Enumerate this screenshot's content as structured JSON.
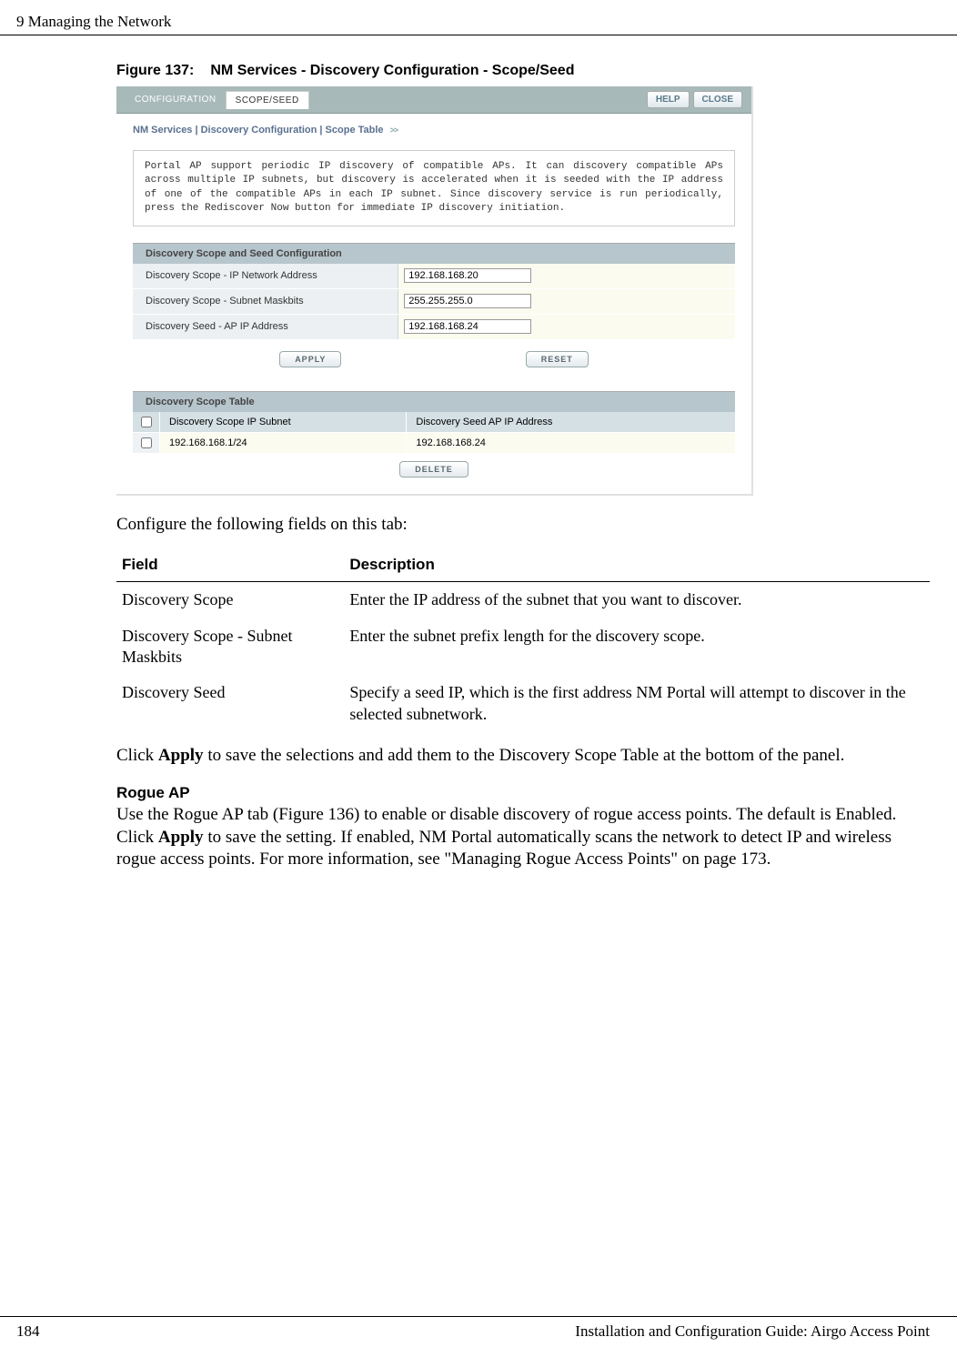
{
  "header": {
    "left": "9  Managing the Network",
    "right": ""
  },
  "figure": {
    "prefix": "Figure 137:",
    "title": "NM Services - Discovery Configuration - Scope/Seed"
  },
  "screenshot": {
    "tabs": {
      "configuration": "CONFIGURATION",
      "scope_seed": "SCOPE/SEED"
    },
    "buttons": {
      "help": "HELP",
      "close": "CLOSE",
      "apply": "APPLY",
      "reset": "RESET",
      "delete": "DELETE"
    },
    "breadcrumb": "NM Services | Discovery Configuration | Scope Table",
    "infobox": "Portal AP support periodic IP discovery of compatible APs. It can discovery compatible APs across multiple IP subnets, but discovery is accelerated when it is seeded with the IP address of one of the compatible APs in each IP subnet. Since discovery service is run periodically, press the Rediscover Now button for immediate IP discovery initiation.",
    "section1": "Discovery Scope and Seed Configuration",
    "rows": {
      "r1_label": "Discovery Scope - IP Network Address",
      "r1_val": "192.168.168.20",
      "r2_label": "Discovery Scope - Subnet Maskbits",
      "r2_val": "255.255.255.0",
      "r3_label": "Discovery Seed - AP IP Address",
      "r3_val": "192.168.168.24"
    },
    "section2": "Discovery Scope Table",
    "table": {
      "h1": "Discovery Scope IP Subnet",
      "h2": "Discovery Seed AP IP Address",
      "d1": "192.168.168.1/24",
      "d2": "192.168.168.24"
    }
  },
  "body": {
    "intro": "Configure the following fields on this tab:",
    "th1": "Field",
    "th2": "Description",
    "rows": [
      {
        "f": "Discovery Scope",
        "d": "Enter the IP address of the subnet that you want to discover."
      },
      {
        "f": "Discovery Scope - Subnet Maskbits",
        "d": "Enter the subnet prefix length for the discovery scope."
      },
      {
        "f": "Discovery Seed",
        "d": "Specify a seed IP, which is the first address NM Portal will attempt to discover in the selected subnetwork."
      }
    ],
    "apply_para_1": "Click ",
    "apply_bold": "Apply",
    "apply_para_2": " to save the selections and add them to the Discovery Scope Table at the bottom of the panel.",
    "rogue_head": "Rogue AP",
    "rogue_1": "Use the Rogue AP tab (Figure 136) to enable or disable discovery of rogue access points. The default is Enabled. Click ",
    "rogue_bold": "Apply",
    "rogue_2": " to save the setting. If enabled, NM Portal automatically scans the network to detect IP and wireless rogue access points. For more information, see \"Managing Rogue Access Points\" on page 173."
  },
  "footer": {
    "left": "184",
    "right": "Installation and Configuration Guide: Airgo Access Point"
  }
}
